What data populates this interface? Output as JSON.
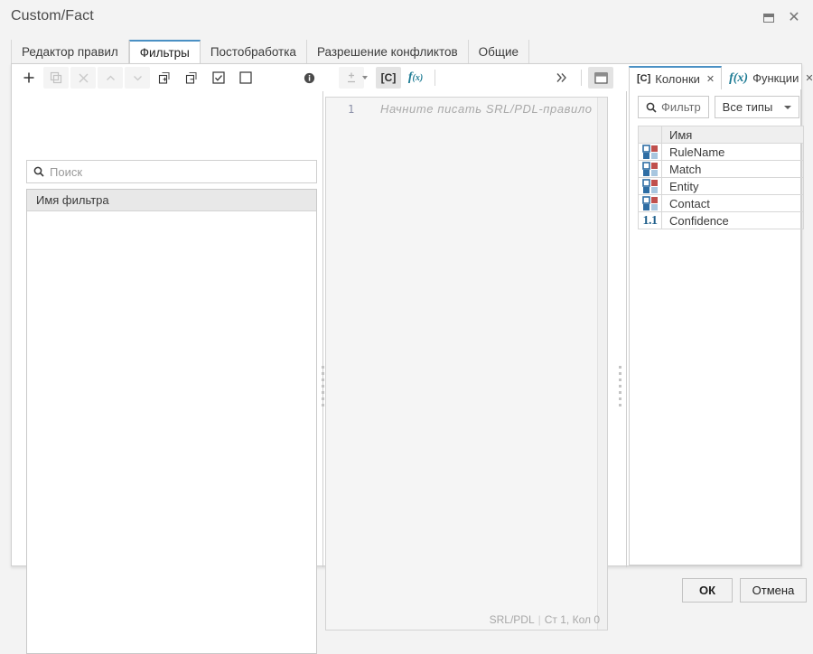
{
  "window": {
    "title": "Custom/Fact",
    "controls": [
      {
        "name": "restore-button",
        "label": ""
      },
      {
        "name": "close-button",
        "label": "✕"
      }
    ]
  },
  "tabs": [
    {
      "label": "Редактор правил",
      "active": false
    },
    {
      "label": "Фильтры",
      "active": true
    },
    {
      "label": "Постобработка",
      "active": false
    },
    {
      "label": "Разрешение конфликтов",
      "active": false
    },
    {
      "label": "Общие",
      "active": false
    }
  ],
  "toolbar": {
    "items": [
      {
        "name": "add-button",
        "icon": "plus-icon",
        "state": "enabled",
        "title": "+"
      },
      {
        "name": "copy-button",
        "icon": "copy-icon",
        "state": "disabled",
        "title": ""
      },
      {
        "name": "delete-button",
        "icon": "close-x-icon",
        "state": "disabled",
        "title": "✕"
      },
      {
        "name": "move-up-button",
        "icon": "chevron-up-icon",
        "state": "disabled",
        "title": "⌃"
      },
      {
        "name": "move-down-button",
        "icon": "chevron-down-icon",
        "state": "disabled",
        "title": "⌄"
      },
      {
        "name": "expand-all-button",
        "icon": "expand-all-icon",
        "state": "enabled",
        "title": ""
      },
      {
        "name": "collapse-all-button",
        "icon": "collapse-all-icon",
        "state": "enabled",
        "title": ""
      },
      {
        "name": "check-all-button",
        "icon": "checkbox-checked-icon",
        "state": "enabled",
        "title": ""
      },
      {
        "name": "uncheck-all-button",
        "icon": "checkbox-empty-icon",
        "state": "enabled",
        "title": ""
      },
      {
        "name": "info-button",
        "icon": "info-icon",
        "state": "enabled",
        "title": ""
      },
      {
        "name": "plusminus-button",
        "icon": "plus-minus-icon",
        "state": "disabled",
        "title": "±"
      },
      {
        "name": "columns-toggle-button",
        "icon": "columns-bracket-icon",
        "state": "selected",
        "title": "[C]"
      },
      {
        "name": "functions-toggle-button",
        "icon": "fx-icon",
        "state": "enabled",
        "title": "f(x)"
      },
      {
        "name": "overflow-button",
        "icon": "chevron-double-right-icon",
        "state": "enabled",
        "title": "»"
      },
      {
        "name": "panel-toggle-button",
        "icon": "panel-icon",
        "state": "selected",
        "title": ""
      }
    ]
  },
  "left_pane": {
    "search": {
      "placeholder": "Поиск",
      "value": "",
      "icon": "search-icon"
    },
    "list_header": "Имя фильтра",
    "rows": []
  },
  "editor": {
    "line_number": "1",
    "placeholder": "Начните писать SRL/PDL-правило",
    "status": {
      "language": "SRL/PDL",
      "separator": "|",
      "position": "Ст 1, Кол 0"
    }
  },
  "right_dock": {
    "tabs": [
      {
        "icon_label": "[C]",
        "icon_name": "columns-bracket-icon",
        "label": "Колонки",
        "close": "✕",
        "active": true
      },
      {
        "icon_label": "f(x)",
        "icon_name": "fx-icon",
        "label": "Функции",
        "close": "✕",
        "active": false
      }
    ],
    "filter_button": {
      "label": "Фильтр",
      "icon": "search-icon"
    },
    "type_select": {
      "label": "Все типы",
      "icon": "chevron-down-icon"
    },
    "table": {
      "columns": [
        "",
        "Имя"
      ],
      "rows": [
        {
          "type": "entity",
          "name": "RuleName"
        },
        {
          "type": "entity",
          "name": "Match"
        },
        {
          "type": "entity",
          "name": "Entity"
        },
        {
          "type": "entity",
          "name": "Contact"
        },
        {
          "type": "number",
          "name": "Confidence"
        }
      ]
    }
  },
  "footer": {
    "ok_label": "ОК",
    "cancel_label": "Отмена"
  },
  "colors": {
    "accent": "#4a90c4",
    "icon_red": "#c0504d",
    "icon_blue_dark": "#2e6da4",
    "icon_blue_light": "#a8c6df",
    "number_icon": "#1f5f8b",
    "panel_bg": "#f3f3f3",
    "editor_bg": "#f5f5f5"
  }
}
